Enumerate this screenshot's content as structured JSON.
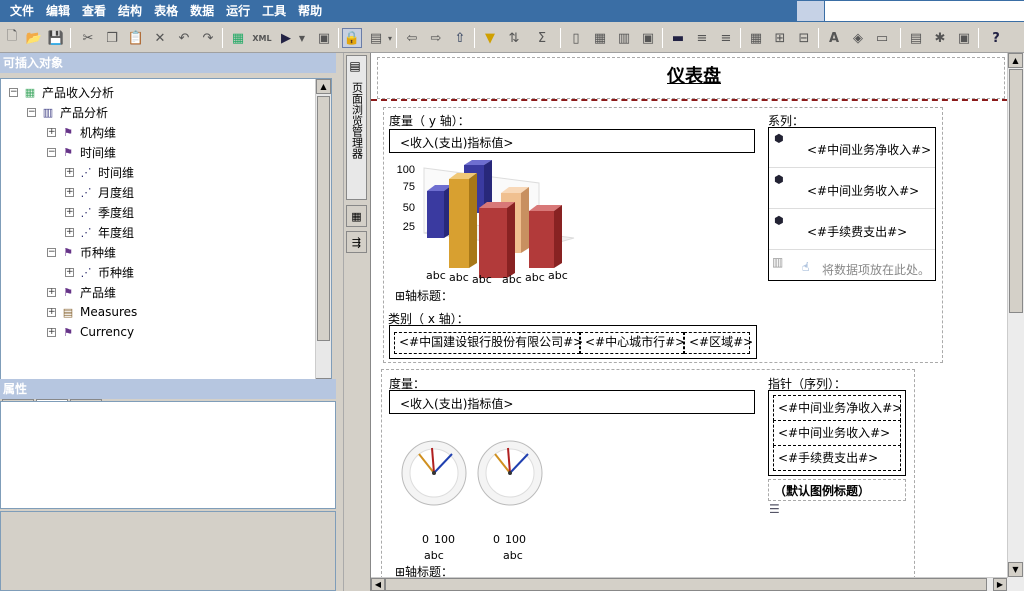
{
  "menu": [
    "文件",
    "编辑",
    "查看",
    "结构",
    "表格",
    "数据",
    "运行",
    "工具",
    "帮助"
  ],
  "left_panel": {
    "insertable_title": "可插入对象",
    "properties_title": "属性",
    "tree": [
      {
        "label": "产品收入分析",
        "icon": "cube-icon"
      },
      {
        "label": "产品分析",
        "icon": "model-icon"
      },
      {
        "label": "机构维",
        "icon": "dimension-icon"
      },
      {
        "label": "时间维",
        "icon": "dimension-icon"
      },
      {
        "label": "时间维",
        "icon": "hierarchy-icon"
      },
      {
        "label": "月度组",
        "icon": "hierarchy-icon"
      },
      {
        "label": "季度组",
        "icon": "hierarchy-icon"
      },
      {
        "label": "年度组",
        "icon": "hierarchy-icon"
      },
      {
        "label": "币种维",
        "icon": "dimension-icon"
      },
      {
        "label": "币种维",
        "icon": "hierarchy-icon"
      },
      {
        "label": "产品维",
        "icon": "dimension-icon"
      },
      {
        "label": "Measures",
        "icon": "measures-icon"
      },
      {
        "label": "Currency",
        "icon": "dimension-icon"
      }
    ]
  },
  "vtab_label": "页面浏览管理器",
  "canvas": {
    "title": "仪表盘",
    "chart1": {
      "measure_label": "度量（ y 轴）：",
      "measure_value": "<收入(支出)指标值>",
      "series_label": "系列：",
      "series": [
        "<#中间业务净收入#>",
        "<#中间业务收入#>",
        "<#手续费支出#>"
      ],
      "drop_hint": "将数据项放在此处。",
      "y_ticks": [
        "100",
        "75",
        "50",
        "25"
      ],
      "x_ticks": [
        "abc",
        "abc",
        "abc",
        "abc",
        "abc",
        "abc"
      ],
      "axis_title": "⊞轴标题：",
      "category_label": "类别（ x 轴）：",
      "categories": [
        "<#中国建设银行股份有限公司#>",
        "<#中心城市行#>",
        "<#区域#>"
      ]
    },
    "chart2": {
      "measure_label": "度量：",
      "measure_value": "<收入(支出)指标值>",
      "pointer_label": "指针（序列）：",
      "pointers": [
        "<#中间业务净收入#>",
        "<#中间业务收入#>",
        "<#手续费支出#>"
      ],
      "legend_title": "（默认图例标题）",
      "gauge_scale_min": "0",
      "gauge_scale_max": "100",
      "gauge_label": "abc",
      "axis_title": "⊞轴标题："
    }
  }
}
